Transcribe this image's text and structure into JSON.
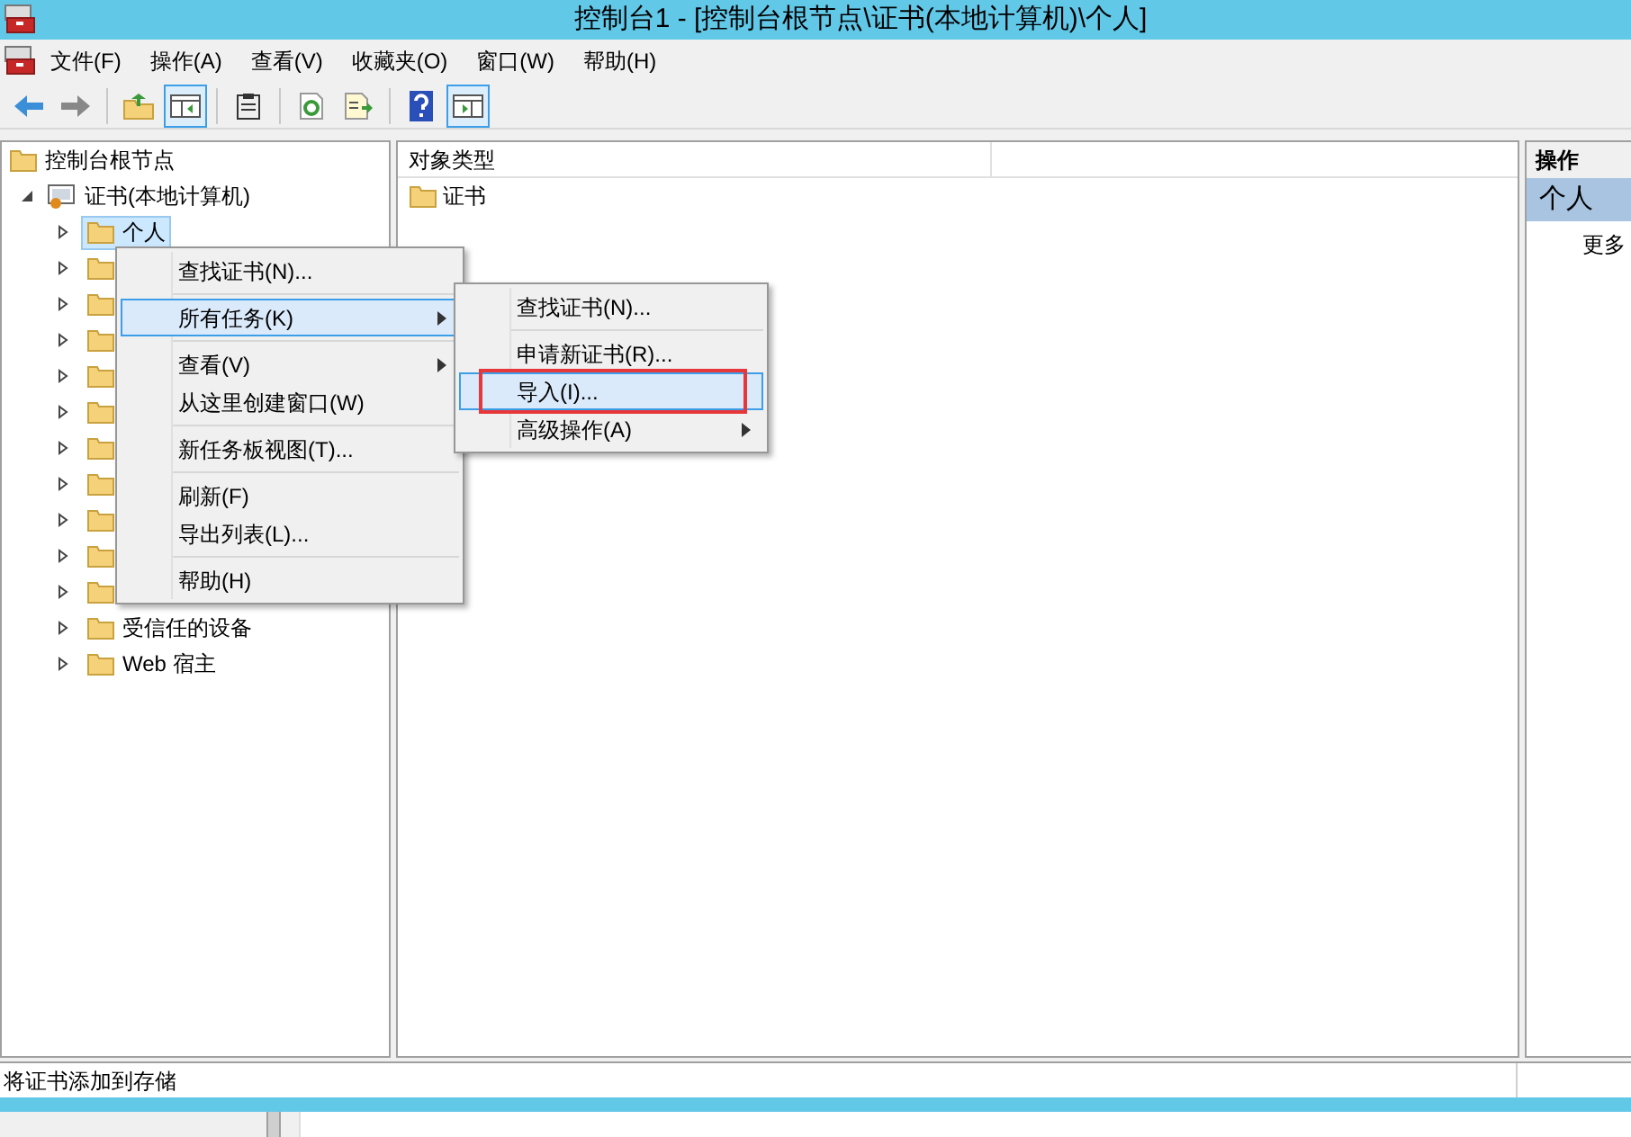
{
  "window": {
    "title": "控制台1 - [控制台根节点\\证书(本地计算机)\\个人]"
  },
  "menu_bar": [
    "文件(F)",
    "操作(A)",
    "查看(V)",
    "收藏夹(O)",
    "窗口(W)",
    "帮助(H)"
  ],
  "toolbar": [
    {
      "kind": "back",
      "on": false
    },
    {
      "kind": "forward",
      "on": false
    },
    {
      "kind": "sep"
    },
    {
      "kind": "up",
      "on": false
    },
    {
      "kind": "tree",
      "on": true
    },
    {
      "kind": "sep"
    },
    {
      "kind": "clipboard",
      "on": false
    },
    {
      "kind": "sep"
    },
    {
      "kind": "refresh",
      "on": false
    },
    {
      "kind": "export",
      "on": false
    },
    {
      "kind": "sep"
    },
    {
      "kind": "help",
      "on": false
    },
    {
      "kind": "panel",
      "on": true
    }
  ],
  "tree": {
    "label": "控制台根节点",
    "children": [
      {
        "label": "证书(本地计算机)",
        "expanded": true,
        "children": [
          {
            "label": "个人",
            "selected": true
          },
          {
            "selected": false
          },
          {
            "selected": false
          },
          {
            "selected": false
          },
          {
            "selected": false
          },
          {
            "selected": false
          },
          {
            "selected": false
          },
          {
            "selected": false
          },
          {
            "selected": false
          },
          {
            "selected": false
          },
          {
            "selected": false
          },
          {
            "label": "受信任的设备",
            "selected": false
          },
          {
            "label": "Web 宿主",
            "selected": false
          }
        ]
      }
    ]
  },
  "list": {
    "columns": [
      "对象类型"
    ],
    "rows": [
      "证书"
    ]
  },
  "actions": {
    "title": "操作",
    "section": "个人",
    "items": [
      "更多"
    ]
  },
  "context_menu": [
    {
      "kind": "item",
      "label": "查找证书(N)...",
      "submenu": false,
      "selected": false
    },
    {
      "kind": "separator"
    },
    {
      "kind": "item",
      "label": "所有任务(K)",
      "submenu": true,
      "selected": true
    },
    {
      "kind": "separator"
    },
    {
      "kind": "item",
      "label": "查看(V)",
      "submenu": true,
      "selected": false
    },
    {
      "kind": "item",
      "label": "从这里创建窗口(W)",
      "submenu": false,
      "selected": false
    },
    {
      "kind": "separator"
    },
    {
      "kind": "item",
      "label": "新任务板视图(T)...",
      "submenu": false,
      "selected": false
    },
    {
      "kind": "separator"
    },
    {
      "kind": "item",
      "label": "刷新(F)",
      "submenu": false,
      "selected": false
    },
    {
      "kind": "item",
      "label": "导出列表(L)...",
      "submenu": false,
      "selected": false
    },
    {
      "kind": "separator"
    },
    {
      "kind": "item",
      "label": "帮助(H)",
      "submenu": false,
      "selected": false
    }
  ],
  "submenu": [
    {
      "kind": "item",
      "label": "查找证书(N)...",
      "submenu": false,
      "selected": false,
      "marked": false
    },
    {
      "kind": "separator"
    },
    {
      "kind": "item",
      "label": "申请新证书(R)...",
      "submenu": false,
      "selected": false,
      "marked": false
    },
    {
      "kind": "item",
      "label": "导入(I)...",
      "submenu": false,
      "selected": true,
      "marked": true
    },
    {
      "kind": "item",
      "label": "高级操作(A)",
      "submenu": true,
      "selected": false,
      "marked": false
    }
  ],
  "status_bar": "将证书添加到存储"
}
